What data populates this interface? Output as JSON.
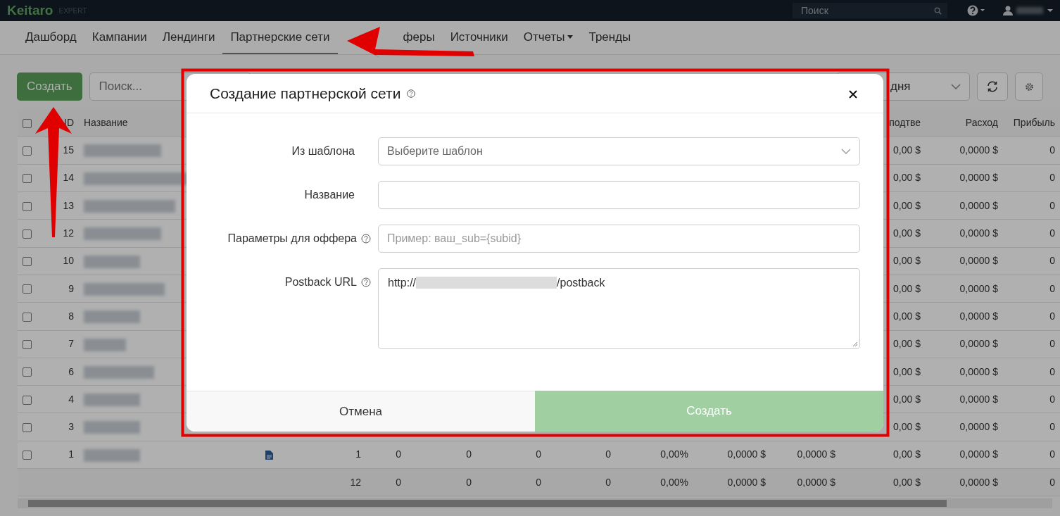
{
  "topbar": {
    "logo": "Keitaro",
    "edition": "EXPERT",
    "search": {
      "placeholder": "Поиск"
    }
  },
  "nav": {
    "tabs": [
      {
        "label": "Дашборд",
        "selected": false,
        "dropdown": false
      },
      {
        "label": "Кампании",
        "selected": false,
        "dropdown": false
      },
      {
        "label": "Лендинги",
        "selected": false,
        "dropdown": false
      },
      {
        "label": "Партнерские сети",
        "selected": true,
        "dropdown": false
      },
      {
        "label": "феры",
        "selected": false,
        "dropdown": false
      },
      {
        "label": "Источники",
        "selected": false,
        "dropdown": false
      },
      {
        "label": "Отчеты",
        "selected": false,
        "dropdown": true
      },
      {
        "label": "Тренды",
        "selected": false,
        "dropdown": false
      }
    ]
  },
  "toolbar": {
    "create_button": "Создать",
    "search": {
      "placeholder": "Поиск..."
    },
    "period_select": "дня"
  },
  "table": {
    "select_all_checked": false,
    "columns": [
      {
        "label": "ID"
      },
      {
        "label": "Название"
      },
      {},
      {},
      {},
      {},
      {},
      {},
      {},
      {},
      {},
      {
        "label": "подтве"
      },
      {
        "label": "Расход"
      },
      {
        "label": "Прибыль"
      }
    ],
    "rows": [
      {
        "id": "15",
        "checked": false,
        "doc_icon": false,
        "cells": [
          null,
          null,
          null,
          null,
          null,
          null,
          null,
          null,
          "0,00 $",
          "0,0000 $",
          "0"
        ]
      },
      {
        "id": "14",
        "checked": false,
        "doc_icon": false,
        "cells": [
          null,
          null,
          null,
          null,
          null,
          null,
          null,
          null,
          "0,00 $",
          "0,0000 $",
          "0"
        ]
      },
      {
        "id": "13",
        "checked": false,
        "doc_icon": false,
        "cells": [
          null,
          null,
          null,
          null,
          null,
          null,
          null,
          null,
          "0,00 $",
          "0,0000 $",
          "0"
        ]
      },
      {
        "id": "12",
        "checked": false,
        "doc_icon": false,
        "cells": [
          null,
          null,
          null,
          null,
          null,
          null,
          null,
          null,
          "0,00 $",
          "0,0000 $",
          "0"
        ]
      },
      {
        "id": "10",
        "checked": false,
        "doc_icon": false,
        "cells": [
          null,
          null,
          null,
          null,
          null,
          null,
          null,
          null,
          "0,00 $",
          "0,0000 $",
          "0"
        ]
      },
      {
        "id": "9",
        "checked": false,
        "doc_icon": false,
        "cells": [
          null,
          null,
          null,
          null,
          null,
          null,
          null,
          null,
          "0,00 $",
          "0,0000 $",
          "0"
        ]
      },
      {
        "id": "8",
        "checked": false,
        "doc_icon": false,
        "cells": [
          null,
          null,
          null,
          null,
          null,
          null,
          null,
          null,
          "0,00 $",
          "0,0000 $",
          "0"
        ]
      },
      {
        "id": "7",
        "checked": false,
        "doc_icon": false,
        "cells": [
          null,
          null,
          null,
          null,
          null,
          null,
          null,
          null,
          "0,00 $",
          "0,0000 $",
          "0"
        ]
      },
      {
        "id": "6",
        "checked": false,
        "doc_icon": false,
        "cells": [
          null,
          null,
          null,
          null,
          null,
          null,
          null,
          null,
          "0,00 $",
          "0,0000 $",
          "0"
        ]
      },
      {
        "id": "4",
        "checked": false,
        "doc_icon": false,
        "cells": [
          null,
          null,
          null,
          null,
          null,
          null,
          null,
          null,
          "0,00 $",
          "0,0000 $",
          "0"
        ]
      },
      {
        "id": "3",
        "checked": false,
        "doc_icon": false,
        "cells": [
          null,
          null,
          null,
          null,
          null,
          null,
          null,
          null,
          "0,00 $",
          "0,0000 $",
          "0"
        ]
      },
      {
        "id": "1",
        "checked": false,
        "doc_icon": true,
        "cells": [
          "1",
          "0",
          "0",
          "0",
          "0",
          "0,00%",
          "0,0000 $",
          "0,0000 $",
          "0,00 $",
          "0,0000 $",
          "0"
        ]
      }
    ],
    "totals": [
      "12",
      "0",
      "0",
      "0",
      "0",
      "0,00%",
      "0,0000 $",
      "0,0000 $",
      "0,00 $",
      "0,0000 $",
      "0"
    ]
  },
  "modal": {
    "title": "Создание партнерской сети",
    "fields": [
      {
        "kind": "select",
        "label": "Из шаблона",
        "help": false,
        "placeholder": "Выберите шаблон"
      },
      {
        "kind": "text",
        "label": "Название",
        "help": false
      },
      {
        "kind": "text",
        "label": "Параметры для оффера",
        "help": true,
        "placeholder": "Пример: ваш_sub={subid}"
      },
      {
        "kind": "textarea",
        "label": "Postback URL",
        "help": true,
        "value_start": "http://",
        "value_end": "/postback"
      }
    ],
    "buttons": [
      {
        "label": "Отмена",
        "kind": "cancel",
        "disabled": false
      },
      {
        "label": "Создать",
        "kind": "submit",
        "disabled": true
      }
    ]
  }
}
